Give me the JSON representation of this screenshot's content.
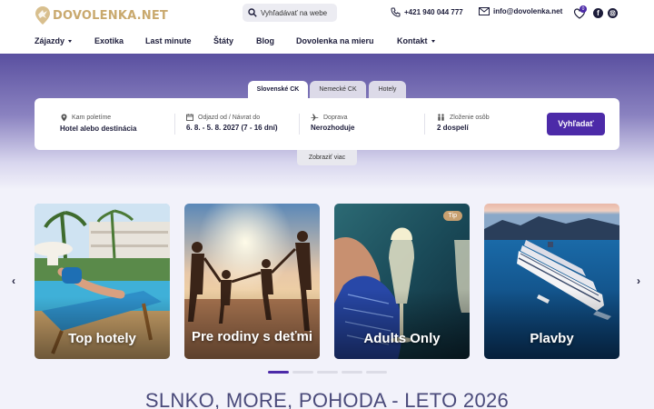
{
  "header": {
    "logo_text": "DOVOLENKA.NET",
    "search_placeholder": "Vyhľadávať na webe",
    "phone": "+421 940 044 777",
    "email": "info@dovolenka.net",
    "favorites_count": "0"
  },
  "nav": {
    "items": [
      {
        "label": "Zájazdy",
        "has_dropdown": true
      },
      {
        "label": "Exotika",
        "has_dropdown": false
      },
      {
        "label": "Last minute",
        "has_dropdown": false
      },
      {
        "label": "Štáty",
        "has_dropdown": false
      },
      {
        "label": "Blog",
        "has_dropdown": false
      },
      {
        "label": "Dovolenka na mieru",
        "has_dropdown": false
      },
      {
        "label": "Kontakt",
        "has_dropdown": true
      }
    ]
  },
  "search_form": {
    "tabs": [
      {
        "label": "Slovenské CK",
        "active": true
      },
      {
        "label": "Nemecké CK",
        "active": false
      },
      {
        "label": "Hotely",
        "active": false
      }
    ],
    "fields": [
      {
        "label": "Kam poletíme",
        "value": "Hotel alebo destinácia",
        "icon": "location-pin-icon"
      },
      {
        "label": "Odjazd od / Návrat do",
        "value": "6. 8. - 5. 8. 2027 (7 - 16 dní)",
        "icon": "calendar-icon"
      },
      {
        "label": "Doprava",
        "value": "Nerozhoduje",
        "icon": "plane-icon"
      },
      {
        "label": "Zloženie osôb",
        "value": "2 dospelí",
        "icon": "people-icon"
      }
    ],
    "submit_label": "Vyhľadať",
    "show_more_label": "Zobraziť viac"
  },
  "carousel": {
    "cards": [
      {
        "title": "Top hotely",
        "badge": ""
      },
      {
        "title": "Pre rodiny s deťmi",
        "badge": ""
      },
      {
        "title": "Adults Only",
        "badge": "Tip"
      },
      {
        "title": "Plavby",
        "badge": ""
      }
    ],
    "prev_icon": "chevron-left-icon",
    "next_icon": "chevron-right-icon",
    "active_dot": 0,
    "dot_count": 5
  },
  "section_heading": "SLNKO, MORE, POHODA - LETO 2026",
  "colors": {
    "accent": "#4c2aa8",
    "logo_gold": "#c9a96e",
    "text_dark": "#1c1c3a"
  }
}
